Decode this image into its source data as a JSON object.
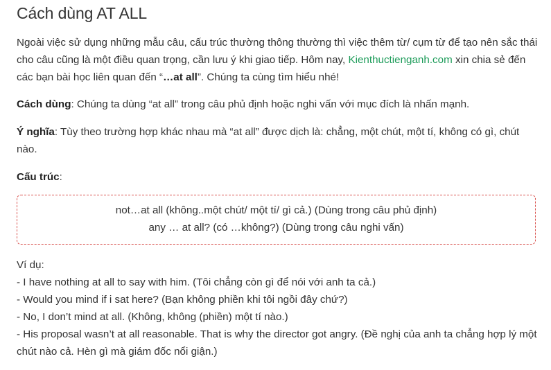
{
  "title": "Cách dùng AT ALL",
  "intro": {
    "before_link": "Ngoài việc sử dụng những mẫu câu, cấu trúc thường thông thường thì việc thêm từ/ cụm từ để tạo nên sắc thái cho câu cũng là một điều quan trọng, cần lưu ý khi giao tiếp. Hôm nay, ",
    "link_text": "Kienthuctienganh.com",
    "after_link": " xin chia sẻ đến các bạn bài học liên quan đến “",
    "highlight": "…at all",
    "end": "”. Chúng ta cùng tìm hiểu nhé!"
  },
  "usage": {
    "label": "Cách dùng",
    "text": ": Chúng ta dùng “at all” trong câu phủ định hoặc nghi vấn với mục đích là nhấn mạnh."
  },
  "meaning": {
    "label": "Ý nghĩa",
    "text": ": Tùy theo trường hợp khác nhau mà “at all” được dịch là: chẳng, một chút, một tí, không có gì, chút nào."
  },
  "structure": {
    "label": "Cấu trúc",
    "suffix": ":",
    "lines": [
      "not…at all (không..một chút/ một tí/ gì cả.) (Dùng trong câu phủ định)",
      "any … at all? (có …không?) (Dùng trong câu nghi vấn)"
    ]
  },
  "examples": {
    "heading": "Ví dụ:",
    "lines": [
      "- I have nothing at all to say with him. (Tôi chẳng còn gì để nói với anh ta cả.)",
      "- Would you mind if i sat here? (Bạn không phiền khi tôi ngồi đây chứ?)",
      "- No, I don’t mind at all. (Không, không (phiền) một tí nào.)",
      "- His proposal wasn’t at all reasonable. That is why the director got angry. (Đề nghị của anh ta chẳng hợp lý một chút nào cả. Hèn gì mà giám đốc nổi giận.)"
    ]
  },
  "colors": {
    "text": "#333333",
    "link": "#1e9c5a",
    "box_border": "#d9534f"
  }
}
